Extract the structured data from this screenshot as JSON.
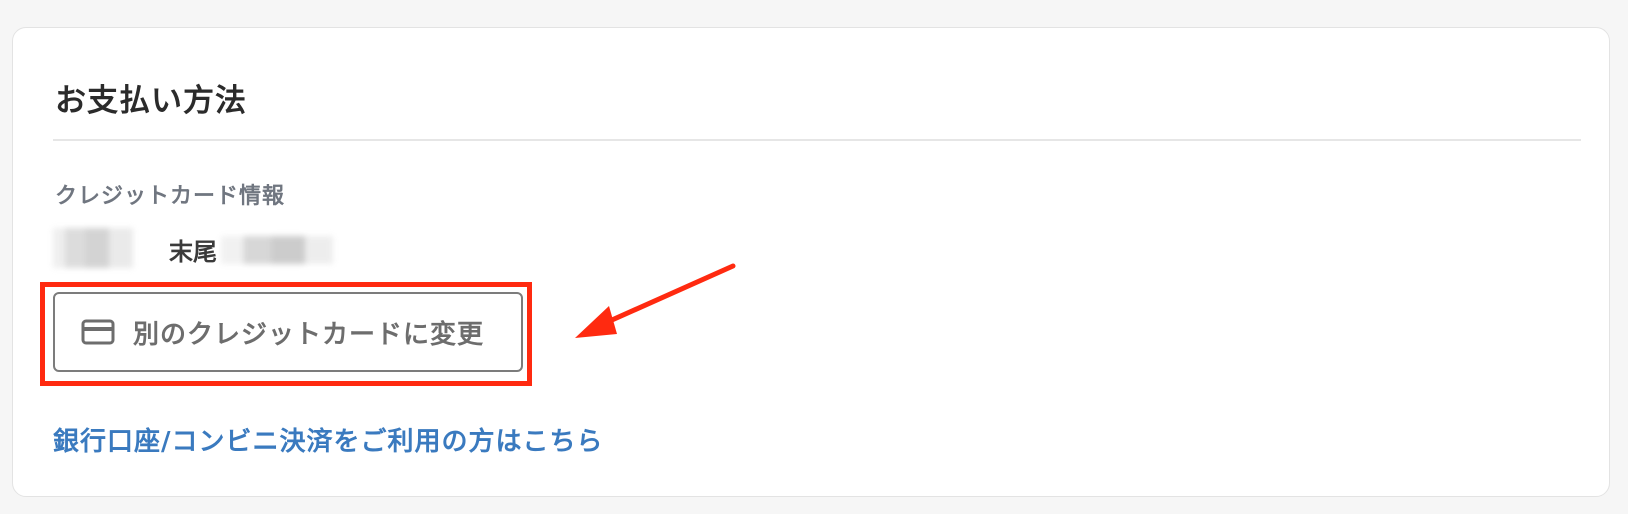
{
  "payment": {
    "title": "お支払い方法",
    "credit_card_label": "クレジットカード情報",
    "masked_card_prefix": "末尾",
    "change_card_button": {
      "icon": "credit-card-icon",
      "label": "別のクレジットカードに変更"
    },
    "alt_payment_link": "銀行口座/コンビニ決済をご利用の方はこちら"
  },
  "annotation": {
    "highlight_color": "#ff2a10",
    "arrow_color": "#ff2a10"
  },
  "colors": {
    "link": "#3a7abf",
    "button_border": "#7c7c7c",
    "label_gray": "#707680"
  }
}
